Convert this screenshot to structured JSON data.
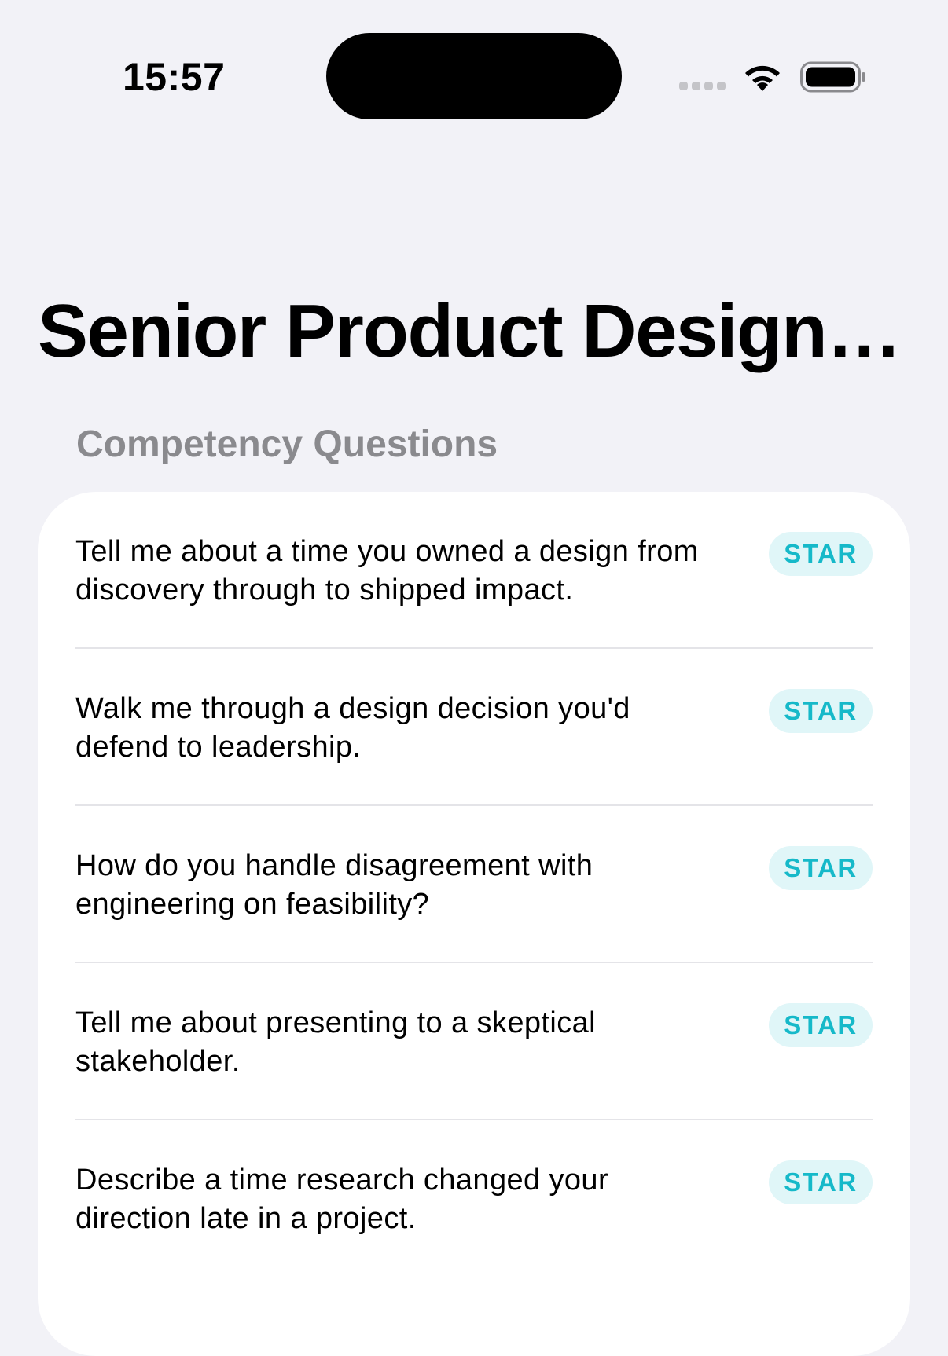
{
  "status_bar": {
    "time": "15:57",
    "icons": [
      "cellular-signal-icon",
      "wifi-icon",
      "battery-icon"
    ]
  },
  "page": {
    "title": "Senior Product Design…"
  },
  "section": {
    "header": "Competency Questions"
  },
  "colors": {
    "background": "#f2f2f7",
    "card": "#ffffff",
    "badge_bg": "#e0f6f8",
    "badge_text": "#16b9c9",
    "section_header": "#8a8a8e"
  },
  "questions": [
    {
      "text": "Tell me about a time you owned a design from discovery through to shipped impact.",
      "badge": "STAR"
    },
    {
      "text": "Walk me through a design decision you'd defend to leadership.",
      "badge": "STAR"
    },
    {
      "text": "How do you handle disagreement with engineering on feasibility?",
      "badge": "STAR"
    },
    {
      "text": "Tell me about presenting to a skeptical stakeholder.",
      "badge": "STAR"
    },
    {
      "text": "Describe a time research changed your direction late in a project.",
      "badge": "STAR"
    }
  ]
}
